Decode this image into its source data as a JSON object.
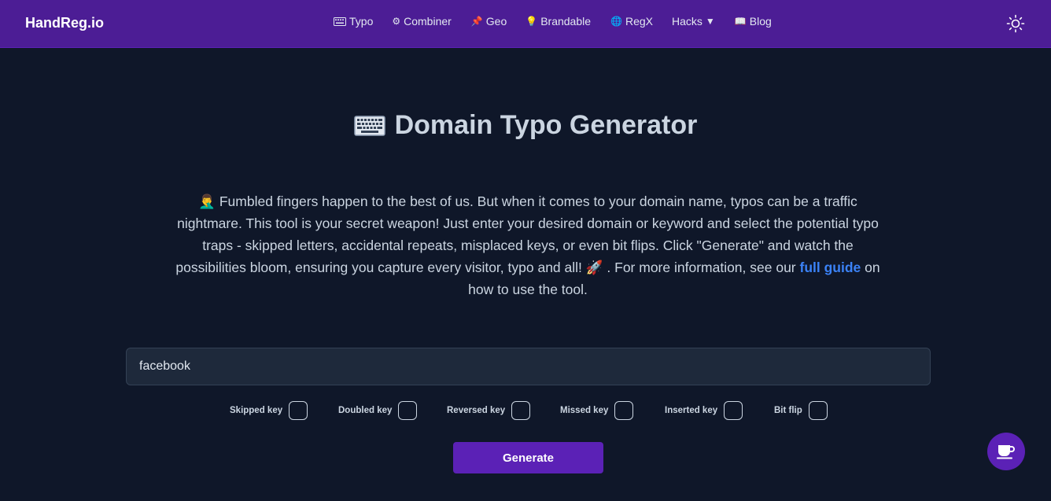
{
  "brand": "HandReg.io",
  "nav": [
    {
      "icon": "keyboard-icon",
      "glyph": "⌨",
      "label": "Typo"
    },
    {
      "icon": "gear-icon",
      "glyph": "⚙",
      "label": "Combiner"
    },
    {
      "icon": "pin-icon",
      "glyph": "📌",
      "label": "Geo"
    },
    {
      "icon": "bulb-icon",
      "glyph": "💡",
      "label": "Brandable"
    },
    {
      "icon": "globe-icon",
      "glyph": "🌐",
      "label": "RegX"
    },
    {
      "icon": "chevron-down-icon",
      "glyph": "▼",
      "label": "Hacks"
    },
    {
      "icon": "book-icon",
      "glyph": "📖",
      "label": "Blog"
    }
  ],
  "title": "Domain Typo Generator",
  "description": {
    "part1": "🤦‍♂️ Fumbled fingers happen to the best of us. But when it comes to your domain name, typos can be a traffic nightmare. This tool is your secret weapon! Just enter your desired domain or keyword and select the potential typo traps - skipped letters, accidental repeats, misplaced keys, or even bit flips. Click \"Generate\" and watch the possibilities bloom, ensuring you capture every visitor, typo and all! 🚀 . For more information, see our ",
    "link": "full guide",
    "part2": " on how to use the tool."
  },
  "search": {
    "value": "facebook"
  },
  "options": [
    {
      "label": "Skipped key",
      "checked": false
    },
    {
      "label": "Doubled key",
      "checked": false
    },
    {
      "label": "Reversed key",
      "checked": false
    },
    {
      "label": "Missed key",
      "checked": false
    },
    {
      "label": "Inserted key",
      "checked": false
    },
    {
      "label": "Bit flip",
      "checked": false
    }
  ],
  "generate_label": "Generate",
  "colors": {
    "navbar": "#4c1d95",
    "background": "#0f1729",
    "accent": "#5b21b6",
    "link": "#3b82f6"
  }
}
